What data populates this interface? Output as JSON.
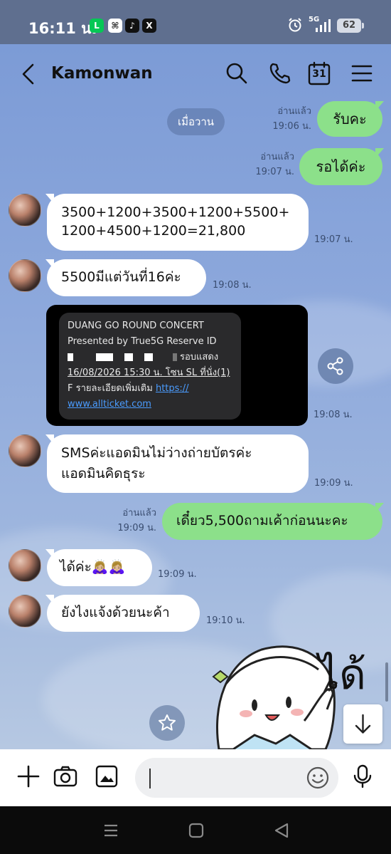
{
  "status_bar": {
    "time": "16:11 น.",
    "apps": [
      "line-icon",
      "capcut-icon",
      "tiktok-icon",
      "x-icon"
    ],
    "network": "5G",
    "battery": "62"
  },
  "header": {
    "contact_name": "Kamonwan",
    "calendar_day": "31"
  },
  "date_chip": "เมื่อวาน",
  "messages": [
    {
      "dir": "out",
      "text": "รับคะ",
      "read": "อ่านแล้ว",
      "time": "19:06 น."
    },
    {
      "dir": "out",
      "text": "รอได้ค่ะ",
      "read": "อ่านแล้ว",
      "time": "19:07 น."
    },
    {
      "dir": "in",
      "lines": [
        "3500+1200+3500+1200+5500+",
        "1200+4500+1200=21,800"
      ],
      "time": "19:07 น."
    },
    {
      "dir": "in",
      "text": "5500มีแต่วันที่16ค่ะ",
      "time": "19:08 น."
    },
    {
      "dir": "in",
      "type": "image",
      "time": "19:08 น."
    },
    {
      "dir": "in",
      "lines": [
        "SMSค่ะแอดมินไม่ว่างถ่ายบัตรค่ะ",
        "แอดมินคิดธุระ"
      ],
      "time": "19:09 น."
    },
    {
      "dir": "out",
      "text": "เดี๋ยว5,500ถามเค้าก่อนนะคะ",
      "read": "อ่านแล้ว",
      "time": "19:09 น."
    },
    {
      "dir": "in",
      "text": "ได้ค่ะ🙇🏼‍♀️🙇🏼‍♀️",
      "time": "19:09 น."
    },
    {
      "dir": "in",
      "text": "ยังไงแจ้งด้วยนะค้า",
      "time": "19:10 น."
    }
  ],
  "sms_image": {
    "line1": "DUANG GO ROUND CONCERT",
    "line2": "Presented by True5G Reserve ID",
    "line3_suffix": "รอบแสดง",
    "line4": "16/08/2026 15:30 น. โซน SL ที่นั่ง(1)",
    "line5_prefix": "F   รายละเอียดเพิ่มเติม ",
    "line5_link": "https://",
    "line6_link": "www.allticket.com"
  },
  "sticker": {
    "text": "ได้"
  },
  "input": {
    "placeholder": ""
  },
  "colors": {
    "out_bubble": "#8ce08a",
    "in_bubble": "#ffffff",
    "chat_bg": "#8ea9dc",
    "status_bar": "#5f6f8f"
  }
}
